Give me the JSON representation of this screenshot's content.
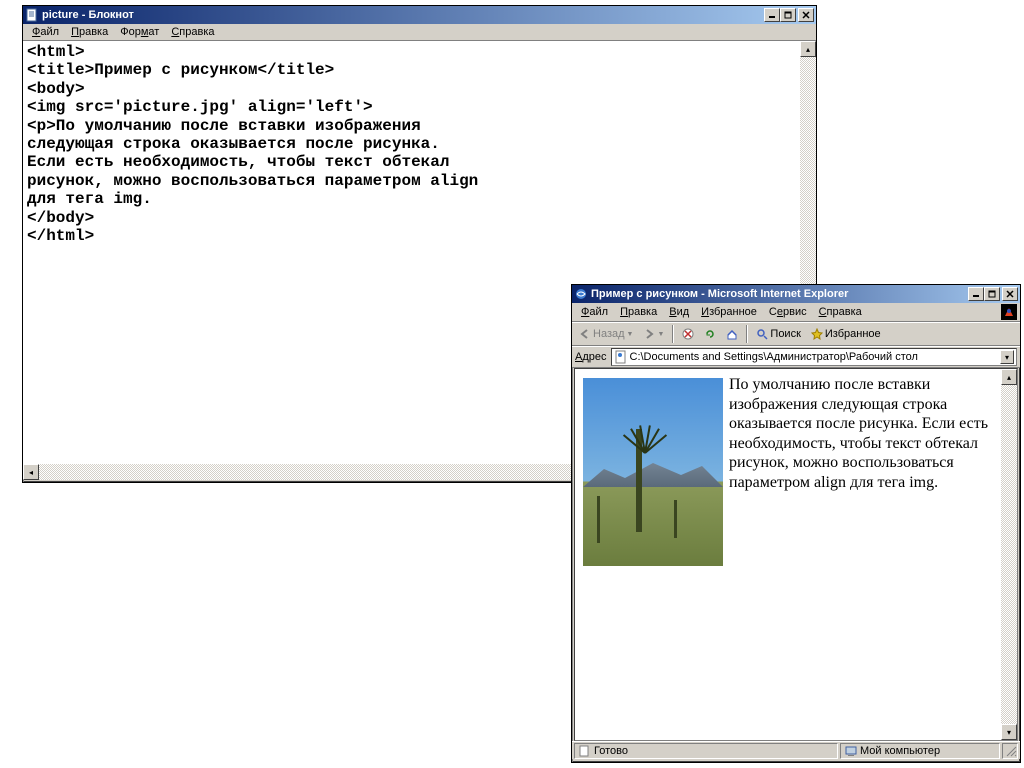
{
  "notepad": {
    "title": "picture - Блокнот",
    "menu": {
      "file": "Файл",
      "edit": "Правка",
      "format": "Формат",
      "help": "Справка"
    },
    "content": "<html>\n<title>Пример с рисунком</title>\n<body>\n<img src='picture.jpg' align='left'>\n<p>По умолчанию после вставки изображения\nследующая строка оказывается после рисунка.\nЕсли есть необходимость, чтобы текст обтекал\nрисунок, можно воспользоваться параметром align\nдля тега img.\n</body>\n</html>"
  },
  "ie": {
    "title": "Пример с рисунком - Microsoft Internet Explorer",
    "menu": {
      "file": "Файл",
      "edit": "Правка",
      "view": "Вид",
      "favorites": "Избранное",
      "tools": "Сервис",
      "help": "Справка"
    },
    "toolbar": {
      "back": "Назад",
      "search": "Поиск",
      "favorites": "Избранное"
    },
    "addr_label": "Адрес",
    "address": "C:\\Documents and Settings\\Администратор\\Рабочий стол",
    "body_text": "По умолчанию после вставки изображения следующая строка оказывается после рисунка. Если есть необходимость, чтобы текст обтекал рисунок, можно воспользоваться параметром align для тега img.",
    "status": {
      "ready": "Готово",
      "zone": "Мой компьютер"
    }
  }
}
